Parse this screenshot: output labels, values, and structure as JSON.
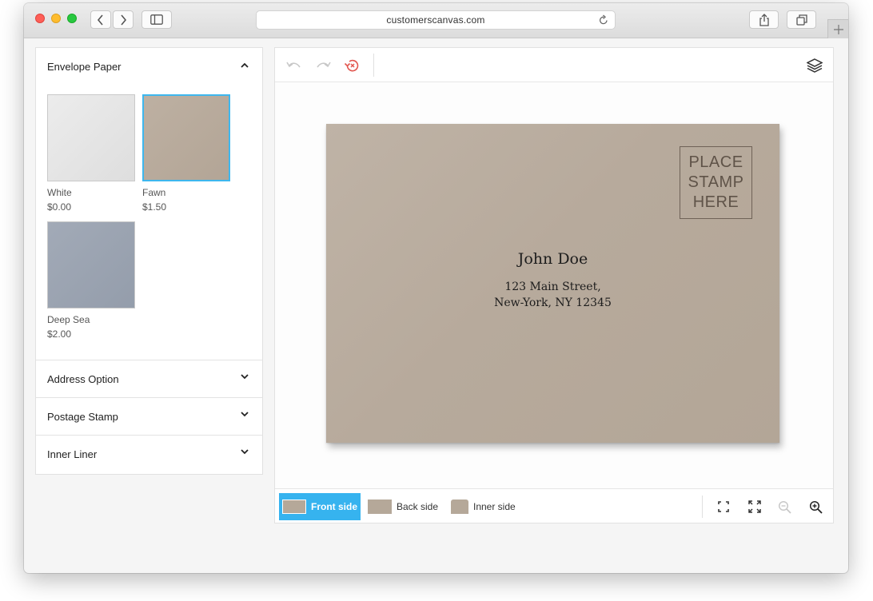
{
  "browser": {
    "url": "customerscanvas.com"
  },
  "sidebar": {
    "sections": [
      {
        "title": "Envelope Paper",
        "expanded": true
      },
      {
        "title": "Address Option",
        "expanded": false
      },
      {
        "title": "Postage Stamp",
        "expanded": false
      },
      {
        "title": "Inner Liner",
        "expanded": false
      }
    ],
    "papers": [
      {
        "name": "White",
        "price": "$0.00",
        "color": "#e6e6e6",
        "selected": false
      },
      {
        "name": "Fawn",
        "price": "$1.50",
        "color": "#b8aa9b",
        "selected": true
      },
      {
        "name": "Deep Sea",
        "price": "$2.00",
        "color": "#9aa3b1",
        "selected": false
      }
    ]
  },
  "envelope": {
    "stamp_lines": [
      "PLACE",
      "STAMP",
      "HERE"
    ],
    "recipient_name": "John Doe",
    "address_line1": "123 Main Street,",
    "address_line2": "New-York, NY 12345"
  },
  "bottombar": {
    "sides": [
      {
        "label": "Front side",
        "active": true
      },
      {
        "label": "Back side",
        "active": false
      },
      {
        "label": "Inner side",
        "active": false
      }
    ]
  },
  "colors": {
    "accent": "#36b3ef",
    "revert_icon": "#e2564f",
    "envelope": "#b8ab9d"
  },
  "icons": {
    "toolbar": [
      "undo-icon",
      "redo-icon",
      "revert-icon",
      "layers-icon"
    ],
    "viewer": [
      "fit-to-screen-icon",
      "fullscreen-icon",
      "zoom-out-icon",
      "zoom-in-icon"
    ]
  }
}
